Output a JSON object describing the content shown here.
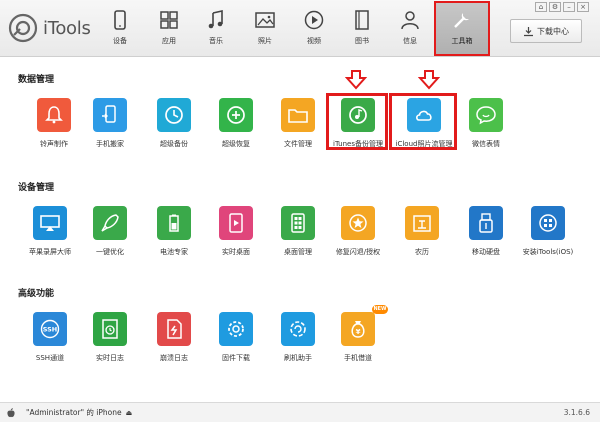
{
  "app": {
    "name": "iTools",
    "version": "3.1.6.6"
  },
  "nav": [
    {
      "label": "设备",
      "icon": "device-icon"
    },
    {
      "label": "应用",
      "icon": "apps-icon"
    },
    {
      "label": "音乐",
      "icon": "music-icon"
    },
    {
      "label": "照片",
      "icon": "photo-icon"
    },
    {
      "label": "视频",
      "icon": "video-icon"
    },
    {
      "label": "图书",
      "icon": "book-icon"
    },
    {
      "label": "信息",
      "icon": "contact-icon"
    },
    {
      "label": "工具箱",
      "icon": "toolbox-icon",
      "active": true
    }
  ],
  "download_center": "下载中心",
  "sections": [
    {
      "title": "数据管理",
      "tools": [
        {
          "label": "铃声制作",
          "color": "#f05a3c"
        },
        {
          "label": "手机搬家",
          "color": "#2d9be6"
        },
        {
          "label": "超级备份",
          "color": "#20a9d6"
        },
        {
          "label": "超级恢复",
          "color": "#33b44a"
        },
        {
          "label": "文件管理",
          "color": "#f4a623"
        },
        {
          "label": "iTunes备份管理",
          "color": "#3aaa48"
        },
        {
          "label": "iCloud照片流管理",
          "color": "#2ba4e3"
        },
        {
          "label": "微信表情",
          "color": "#4cc04a"
        }
      ]
    },
    {
      "title": "设备管理",
      "tools": [
        {
          "label": "苹果录屏大师",
          "color": "#1c8fd8"
        },
        {
          "label": "一键优化",
          "color": "#3aa94a"
        },
        {
          "label": "电池专家",
          "color": "#3aa94a"
        },
        {
          "label": "实时桌面",
          "color": "#e0457b"
        },
        {
          "label": "桌面管理",
          "color": "#3aa94a"
        },
        {
          "label": "修复闪退/授权",
          "color": "#f4a623"
        },
        {
          "label": "农历",
          "color": "#f4a623"
        },
        {
          "label": "移动硬盘",
          "color": "#2277c8"
        },
        {
          "label": "安装iTools(iOS)",
          "color": "#2277c8"
        }
      ]
    },
    {
      "title": "高级功能",
      "tools": [
        {
          "label": "SSH通道",
          "color": "#2b88d8"
        },
        {
          "label": "实时日志",
          "color": "#2fa544"
        },
        {
          "label": "崩溃日志",
          "color": "#e24a4a"
        },
        {
          "label": "固件下载",
          "color": "#1f9be0"
        },
        {
          "label": "刷机助手",
          "color": "#1f9be0"
        },
        {
          "label": "手机借道",
          "color": "#f4a623"
        }
      ]
    }
  ],
  "new_badge": "NEW",
  "status": {
    "device": "\"Administrator\" 的 iPhone"
  }
}
